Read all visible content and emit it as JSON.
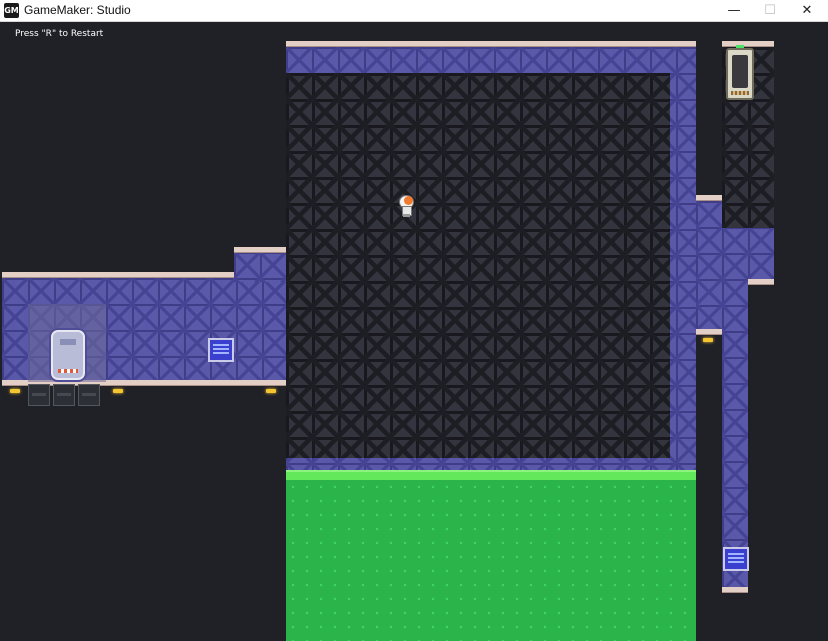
{
  "window": {
    "title": "GameMaker: Studio",
    "icon_label": "GM",
    "minimize_glyph": "—",
    "maximize_glyph": "☐",
    "close_glyph": "✕"
  },
  "game": {
    "hint_text": "Press \"R\" to Restart",
    "objects": {
      "player": "astronaut-player",
      "hazard": "acid-pool",
      "pickups": [
        "cryo-pod",
        "computer-terminal",
        "computer-terminal"
      ],
      "exit": "exit-door"
    }
  }
}
